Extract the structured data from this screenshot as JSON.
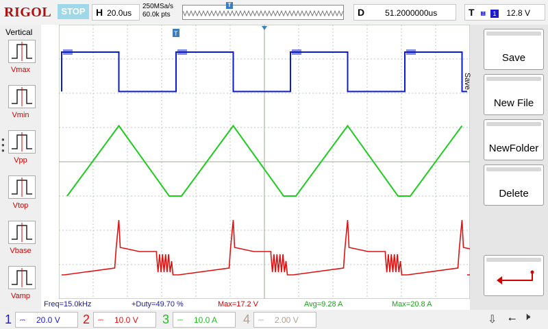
{
  "brand": "RIGOL",
  "run_state": "STOP",
  "horizontal": {
    "key": "H",
    "timebase": "20.0us"
  },
  "acquisition": {
    "rate": "250MSa/s",
    "points": "60.0k pts"
  },
  "delay": {
    "key": "D",
    "value": "51.2000000us"
  },
  "trigger": {
    "key": "T",
    "source": "1",
    "level": "12.8 V"
  },
  "colors": {
    "ch1": "#0a1ad0",
    "ch2": "#e01010",
    "ch3": "#1ecb1e",
    "ch4": "#c8b8a8",
    "grid": "#b8c8b8"
  },
  "left_menu": {
    "title": "Vertical",
    "items": [
      {
        "label": "Vmax"
      },
      {
        "label": "Vmin"
      },
      {
        "label": "Vpp"
      },
      {
        "label": "Vtop"
      },
      {
        "label": "Vbase"
      },
      {
        "label": "Vamp"
      }
    ]
  },
  "measurements": [
    {
      "text": "Freq=15.0kHz",
      "color": "#1a1aa0"
    },
    {
      "text": "+Duty=49.70 %",
      "color": "#1a1aa0"
    },
    {
      "text": "Max=17.2 V",
      "color": "#d00000"
    },
    {
      "text": "Avg=9.28 A",
      "color": "#20a020"
    },
    {
      "text": "Max=20.8 A",
      "color": "#20a020"
    }
  ],
  "right_menu": {
    "tab": "Save",
    "buttons": [
      {
        "label": "Save"
      },
      {
        "label": "New File"
      },
      {
        "label": "NewFolder"
      },
      {
        "label": "Delete"
      }
    ],
    "return_icon": "return-arrow-icon"
  },
  "channels": [
    {
      "num": "1",
      "scale": "20.0 V",
      "color": "#1a1ad0"
    },
    {
      "num": "2",
      "scale": "10.0 V",
      "color": "#e01010"
    },
    {
      "num": "3",
      "scale": "10.0 A",
      "color": "#20c020"
    },
    {
      "num": "4",
      "scale": "2.00 V",
      "color": "#b0a090"
    }
  ],
  "chart_data": {
    "type": "line",
    "grid": true,
    "x_divisions": 12,
    "y_divisions": 8,
    "series": [
      {
        "marker": "1",
        "shape": "square",
        "high_div": 0.8,
        "low_div": 1.95,
        "color": "#0a1ad0"
      },
      {
        "marker": "3",
        "shape": "triangle",
        "high_div": 2.95,
        "low_div": 5.0,
        "color": "#1ecb1e"
      },
      {
        "marker": "2",
        "shape": "switching",
        "high_div": 6.5,
        "low_div": 7.3,
        "color": "#e01010"
      }
    ]
  }
}
